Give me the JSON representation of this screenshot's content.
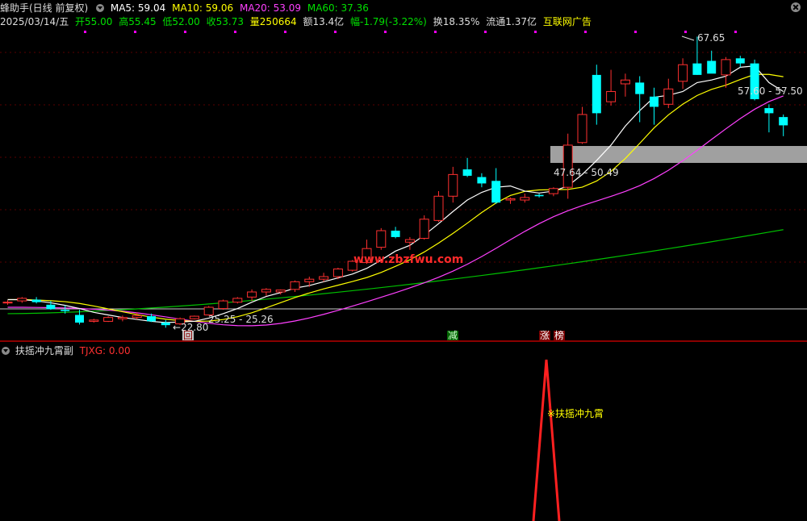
{
  "header": {
    "name": "蜂助手(日线 前复权)",
    "ma5": "MA5: 59.04",
    "ma10": "MA10: 59.06",
    "ma20": "MA20: 53.09",
    "ma60": "MA60: 37.36",
    "date": "2025/03/14/五",
    "open": "开55.00",
    "high": "高55.45",
    "low": "低52.00",
    "close": "收53.73",
    "volume": "量250664",
    "amount": "额13.4亿",
    "change": "幅-1.79(-3.22%)",
    "turnover": "换18.35%",
    "float": "流通1.37亿",
    "ad": "互联网广告"
  },
  "annotations": {
    "peak_label": "67.65",
    "upper_zone_label": "57.60 - 57.50",
    "lower_zone_label": "47.64 - 50.49",
    "low_range_label": "25.25 - 25.26",
    "low_label": "22.80",
    "watermark": "www.zbzfwu.com"
  },
  "markers": {
    "hui": "回",
    "jian": "减",
    "zhang": "涨",
    "bang": "榜"
  },
  "indicator": {
    "title": "扶摇冲九霄副",
    "value_label": "TJXG: 0.00",
    "signal_label": "※扶摇冲九霄"
  },
  "chart_data": {
    "type": "candlestick",
    "series": [
      {
        "name": "MA5",
        "value": 59.04
      },
      {
        "name": "MA10",
        "value": 59.06
      },
      {
        "name": "MA20",
        "value": 53.09
      },
      {
        "name": "MA60",
        "value": 37.36
      }
    ],
    "candles": [
      [
        26.0,
        26.3,
        25.6,
        26.0
      ],
      [
        26.2,
        26.8,
        25.9,
        26.6
      ],
      [
        26.4,
        26.8,
        25.8,
        26.0
      ],
      [
        25.6,
        26.2,
        24.8,
        24.9
      ],
      [
        24.8,
        25.5,
        24.2,
        24.6
      ],
      [
        24.0,
        24.8,
        22.5,
        22.8
      ],
      [
        23.0,
        23.4,
        22.8,
        23.2
      ],
      [
        23.0,
        23.8,
        22.9,
        23.6
      ],
      [
        23.4,
        23.9,
        23.0,
        23.6
      ],
      [
        23.6,
        24.4,
        23.3,
        23.9
      ],
      [
        23.8,
        24.2,
        22.9,
        23.0
      ],
      [
        22.8,
        23.2,
        22.0,
        22.4
      ],
      [
        22.6,
        23.6,
        22.4,
        23.4
      ],
      [
        23.4,
        23.9,
        23.3,
        23.8
      ],
      [
        24.0,
        25.4,
        23.9,
        25.2
      ],
      [
        25.0,
        26.4,
        24.8,
        26.2
      ],
      [
        26.0,
        26.8,
        25.8,
        26.6
      ],
      [
        26.8,
        28.0,
        26.2,
        27.6
      ],
      [
        27.6,
        28.2,
        27.0,
        28.0
      ],
      [
        27.6,
        28.0,
        27.2,
        27.9
      ],
      [
        28.0,
        29.4,
        27.6,
        29.2
      ],
      [
        29.2,
        30.0,
        28.4,
        29.6
      ],
      [
        29.6,
        30.6,
        29.2,
        30.0
      ],
      [
        30.0,
        31.4,
        29.6,
        31.2
      ],
      [
        31.0,
        32.6,
        30.8,
        32.4
      ],
      [
        32.2,
        35.8,
        32.0,
        34.4
      ],
      [
        34.6,
        37.6,
        34.2,
        37.2
      ],
      [
        37.2,
        37.8,
        36.0,
        36.2
      ],
      [
        35.4,
        36.2,
        34.2,
        35.8
      ],
      [
        36.0,
        39.6,
        35.8,
        39.0
      ],
      [
        38.8,
        43.4,
        38.6,
        42.6
      ],
      [
        42.6,
        47.2,
        41.6,
        46.0
      ],
      [
        46.8,
        48.6,
        45.6,
        45.8
      ],
      [
        45.6,
        46.2,
        44.0,
        44.6
      ],
      [
        45.0,
        47.0,
        41.4,
        41.6
      ],
      [
        42.0,
        42.4,
        41.4,
        42.2
      ],
      [
        42.0,
        43.0,
        41.6,
        42.4
      ],
      [
        42.8,
        43.0,
        42.4,
        42.6
      ],
      [
        43.0,
        44.0,
        42.6,
        43.8
      ],
      [
        44.0,
        52.4,
        42.2,
        50.6
      ],
      [
        51.0,
        56.6,
        50.8,
        55.4
      ],
      [
        61.6,
        63.2,
        53.8,
        55.6
      ],
      [
        57.4,
        62.4,
        56.8,
        59.0
      ],
      [
        60.2,
        61.8,
        58.2,
        60.8
      ],
      [
        60.4,
        61.4,
        54.2,
        58.6
      ],
      [
        58.2,
        59.6,
        53.8,
        56.6
      ],
      [
        57.0,
        61.0,
        56.4,
        59.4
      ],
      [
        60.6,
        64.2,
        59.4,
        63.2
      ],
      [
        63.4,
        67.6,
        61.6,
        61.6
      ],
      [
        63.8,
        65.4,
        62.2,
        61.8
      ],
      [
        61.6,
        64.4,
        59.6,
        64.0
      ],
      [
        64.2,
        64.6,
        62.8,
        63.4
      ],
      [
        63.4,
        64.0,
        57.6,
        57.8
      ],
      [
        56.4,
        57.0,
        52.6,
        55.6
      ],
      [
        55.0,
        55.4,
        52.0,
        53.7
      ]
    ],
    "ma5_values": [
      26.4,
      26.4,
      26.2,
      25.9,
      25.5,
      25.0,
      24.4,
      24.0,
      23.6,
      23.3,
      23.0,
      22.8,
      22.9,
      23.0,
      23.5,
      24.2,
      25.0,
      26.0,
      26.9,
      27.5,
      28.2,
      28.6,
      29.2,
      29.8,
      30.4,
      31.3,
      32.6,
      34.0,
      34.9,
      36.5,
      38.3,
      40.2,
      42.0,
      43.2,
      44.0,
      44.2,
      43.4,
      43.1,
      43.4,
      44.2,
      46.0,
      48.2,
      50.6,
      53.6,
      56.0,
      58.1,
      58.4,
      59.0,
      60.4,
      60.8,
      61.4,
      62.8,
      63.0,
      60.4,
      59.0
    ],
    "ma60_start": 24.2,
    "ma60_end": 37.36,
    "ylim": [
      22.8,
      67.65
    ]
  }
}
